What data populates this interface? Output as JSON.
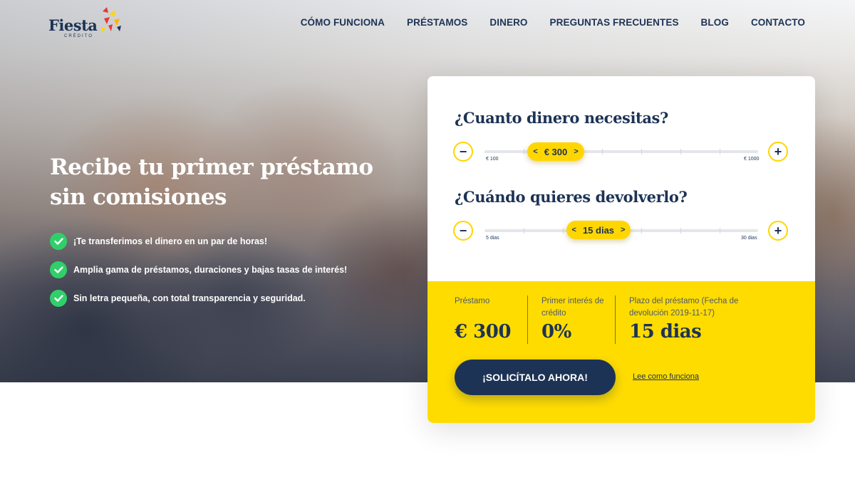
{
  "brand": {
    "name": "Fiesta",
    "sub": "CRÉDITO"
  },
  "nav": [
    {
      "label": "CÓMO FUNCIONA"
    },
    {
      "label": "PRÉSTAMOS"
    },
    {
      "label": "DINERO"
    },
    {
      "label": "PREGUNTAS FRECUENTES"
    },
    {
      "label": "BLOG"
    },
    {
      "label": "CONTACTO"
    }
  ],
  "hero": {
    "title_line1": "Recibe tu primer préstamo",
    "title_line2": "sin comisiones",
    "features": [
      {
        "text": "¡Te transferimos el dinero en un par de horas!"
      },
      {
        "text": "Amplia gama de préstamos, duraciones y bajas tasas de interés!"
      },
      {
        "text": "Sin letra pequeña, con total transparencia y seguridad."
      }
    ]
  },
  "calculator": {
    "amount": {
      "question": "¿Cuanto dinero necesitas?",
      "value": "€ 300",
      "min_label": "€ 100",
      "max_label": "€ 1000",
      "minus": "−",
      "plus": "+"
    },
    "term": {
      "question": "¿Cuándo quieres devolverlo?",
      "value": "15 dias",
      "min_label": "5 dias",
      "max_label": "30 dias",
      "minus": "−",
      "plus": "+"
    },
    "summary": {
      "loan_label": "Préstamo",
      "loan_value": "€ 300",
      "interest_label": "Primer interés de crédito",
      "interest_value": "0%",
      "term_label": "Plazo del préstamo (Fecha de devolución 2019-11-17)",
      "term_value": "15 dias"
    },
    "cta_label": "¡SOLICÍTALO AHORA!",
    "how_link": "Lee como funciona"
  },
  "colors": {
    "navy": "#1d3355",
    "yellow": "#ffdc00",
    "green": "#2fd06a"
  }
}
